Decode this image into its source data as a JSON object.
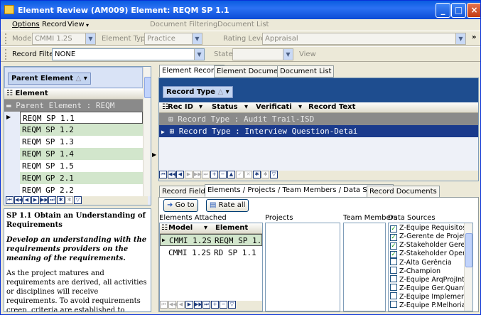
{
  "window": {
    "title": "Element Review (AM009) Element: REQM SP 1.1",
    "controls": [
      "_",
      "□",
      "×"
    ]
  },
  "menu": [
    "Options",
    "Record",
    "View"
  ],
  "toolbar1": {
    "doc_filtering": "Document Filtering",
    "doc_list": "Document List",
    "model_label": "Model",
    "model_value": "CMMI 1.2S",
    "element_type_label": "Element Type",
    "element_type_value": "Practice",
    "rating_level_label": "Rating Level",
    "rating_level_value": "Appraisal"
  },
  "toolbar2": {
    "record_filter_label": "Record Filter",
    "record_filter_value": "NONE",
    "state_label": "State",
    "state_value": "",
    "view_label": "View"
  },
  "left": {
    "group_chip": "Parent Element",
    "column": "Element",
    "group_row": "Parent Element : REQM",
    "rows": [
      "REQM SP 1.1",
      "REQM SP 1.2",
      "REQM SP 1.3",
      "REQM SP 1.4",
      "REQM SP 1.5",
      "REQM GP 2.1",
      "REQM GP 2.2"
    ],
    "desc_title": "SP 1.1 Obtain an Understanding of Requirements",
    "desc_italic": "Develop an understanding with the requirements providers on the meaning of the requirements.",
    "desc_body": "As the project matures and requirements are derived, all activities or disciplines will receive requirements. To avoid requirements creep, criteria are established to designate appropriate"
  },
  "right": {
    "tabs": [
      "Element Records",
      "Element Documents",
      "Document List"
    ],
    "group_chip": "Record Type",
    "columns": [
      "Rec ID",
      "Status",
      "Verificati",
      "Record Text"
    ],
    "groups": [
      "Record Type : Audit Trail-ISD",
      "Record Type : Interview Question-Detai"
    ],
    "bottom_tabs": [
      "Record Fields",
      "Elements / Projects / Team Members / Data Sources",
      "Record Documents"
    ],
    "goto_label": "Go to",
    "rate_all_label": "Rate all",
    "elements_attached_label": "Elements Attached",
    "projects_label": "Projects",
    "team_members_label": "Team Members",
    "data_sources_label": "Data Sources",
    "attached_cols": [
      "Model",
      "Element"
    ],
    "attached_rows": [
      {
        "model": "CMMI 1.2S",
        "element": "REQM SP 1."
      },
      {
        "model": "CMMI 1.2S",
        "element": "RD SP 1.1"
      }
    ],
    "data_sources": [
      {
        "label": "Z-Equipe Requisitos",
        "checked": true
      },
      {
        "label": "Z-Gerente de Projeto",
        "checked": true
      },
      {
        "label": "Z-Stakeholder Gerenc",
        "checked": true
      },
      {
        "label": "Z-Stakeholder Operac",
        "checked": true
      },
      {
        "label": "Z-Alta Gerência",
        "checked": false
      },
      {
        "label": "Z-Champion",
        "checked": false
      },
      {
        "label": "Z-Equipe ArqProjInteg",
        "checked": false
      },
      {
        "label": "Z-Equipe Ger.Quantita",
        "checked": false
      },
      {
        "label": "Z-Equipe Implementac",
        "checked": false
      },
      {
        "label": "Z-Equipe P.Melhoria",
        "checked": false
      }
    ]
  }
}
